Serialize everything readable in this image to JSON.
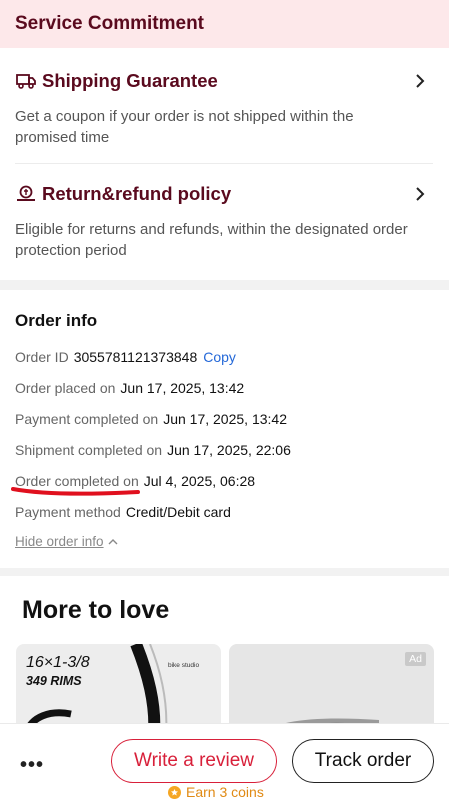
{
  "service": {
    "title": "Service Commitment",
    "shipping": {
      "title": "Shipping Guarantee",
      "icon": "truck-icon",
      "desc": "Get a coupon if your order is not shipped within the promised time"
    },
    "refund": {
      "title": "Return&refund policy",
      "icon": "refund-icon",
      "desc": "Eligible for returns and refunds, within the designated order protection period"
    }
  },
  "order": {
    "title": "Order info",
    "id_label": "Order ID",
    "id_value": "3055781121373848",
    "copy_label": "Copy",
    "placed_label": "Order placed on",
    "placed_value": "Jun 17, 2025, 13:42",
    "payment_label": "Payment completed on",
    "payment_value": "Jun 17, 2025, 13:42",
    "shipment_label": "Shipment completed on",
    "shipment_value": "Jun 17, 2025, 22:06",
    "completed_label": "Order completed on",
    "completed_value": "Jul 4, 2025, 06:28",
    "method_label": "Payment method",
    "method_value": "Credit/Debit card",
    "hide_label": "Hide order info"
  },
  "more": {
    "title": "More to love",
    "card1": {
      "line1": "16×1-3/8",
      "line2": "349 RIMS",
      "brand": "bike studio"
    },
    "card2": {
      "ad": "Ad"
    }
  },
  "bottom": {
    "more_label": "•••",
    "review_label": "Write a review",
    "track_label": "Track order",
    "coins_label": "Earn 3 coins"
  },
  "colors": {
    "brand_dark": "#5a0a1e",
    "accent_red": "#d8203a",
    "link_blue": "#2468d8",
    "coin_orange": "#e08a14"
  }
}
